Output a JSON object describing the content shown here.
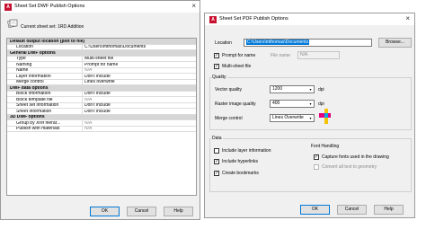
{
  "left_dialog": {
    "title": "Sheet Set DWF Publish Options",
    "app_icon": "A",
    "close_icon": "×",
    "sheet_set_label": "Current sheet set: 1RD Addition",
    "rows": [
      {
        "kind": "cat",
        "label": "Default output location (plot to file)"
      },
      {
        "kind": "prop",
        "label": "Location",
        "value": "C:\\Users\\mthomas\\Documents"
      },
      {
        "kind": "cat",
        "label": "General DWF options"
      },
      {
        "kind": "prop",
        "label": "Type",
        "value": "Multi-sheet file"
      },
      {
        "kind": "prop",
        "label": "Naming",
        "value": "Prompt for name"
      },
      {
        "kind": "prop",
        "label": "Name",
        "value": "N/A",
        "muted": true
      },
      {
        "kind": "prop",
        "label": "Layer information",
        "value": "Don't include"
      },
      {
        "kind": "prop",
        "label": "Merge control",
        "value": "Lines overwrite"
      },
      {
        "kind": "cat",
        "label": "DWF data options"
      },
      {
        "kind": "prop",
        "label": "Block information",
        "value": "Don't include"
      },
      {
        "kind": "prop",
        "label": "Block template file",
        "value": "N/A",
        "muted": true
      },
      {
        "kind": "prop",
        "label": "Sheet set information",
        "value": "Don't include"
      },
      {
        "kind": "prop",
        "label": "Sheet information",
        "value": "Don't include"
      },
      {
        "kind": "cat",
        "label": "3D DWF options"
      },
      {
        "kind": "prop",
        "label": "Group by Xref hierar...",
        "value": "N/A",
        "muted": true
      },
      {
        "kind": "prop",
        "label": "Publish with materials",
        "value": "N/A",
        "muted": true
      }
    ],
    "buttons": {
      "ok": "OK",
      "cancel": "Cancel",
      "help": "Help"
    }
  },
  "right_dialog": {
    "title": "Sheet Set PDF Publish Options",
    "app_icon": "A",
    "close_icon": "×",
    "location_label": "Location",
    "location_value": "C:\\Users\\mthomas\\Documents",
    "browse_label": "Browse...",
    "prompt_for_name_label": "Prompt for name",
    "prompt_for_name_checked": true,
    "file_name_label": "File name",
    "file_name_value": "N/A",
    "multi_sheet_label": "Multi-sheet file",
    "multi_sheet_checked": true,
    "quality_title": "Quality",
    "vector_quality_label": "Vector quality",
    "vector_quality_value": "1200",
    "vector_quality_unit": "dpi",
    "raster_quality_label": "Raster image quality",
    "raster_quality_value": "400",
    "raster_quality_unit": "dpi",
    "merge_control_label": "Merge control",
    "merge_control_value": "Lines Overwrite",
    "data_title": "Data",
    "include_layer_label": "Include layer information",
    "include_layer_checked": false,
    "include_hyperlinks_label": "Include hyperlinks",
    "include_hyperlinks_checked": true,
    "create_bookmarks_label": "Create bookmarks",
    "create_bookmarks_checked": true,
    "font_handling_title": "Font Handling",
    "capture_fonts_label": "Capture fonts used in the drawing",
    "capture_fonts_checked": true,
    "convert_text_label": "Convert all text to geometry",
    "convert_text_checked": false,
    "check_glyph": "✓",
    "dropdown_arrow": "▾",
    "buttons": {
      "ok": "OK",
      "cancel": "Cancel",
      "help": "Help"
    }
  },
  "colors": {
    "accent": "#0078d7",
    "brand": "#c8102e",
    "category_bg": "#d6d6d6"
  }
}
